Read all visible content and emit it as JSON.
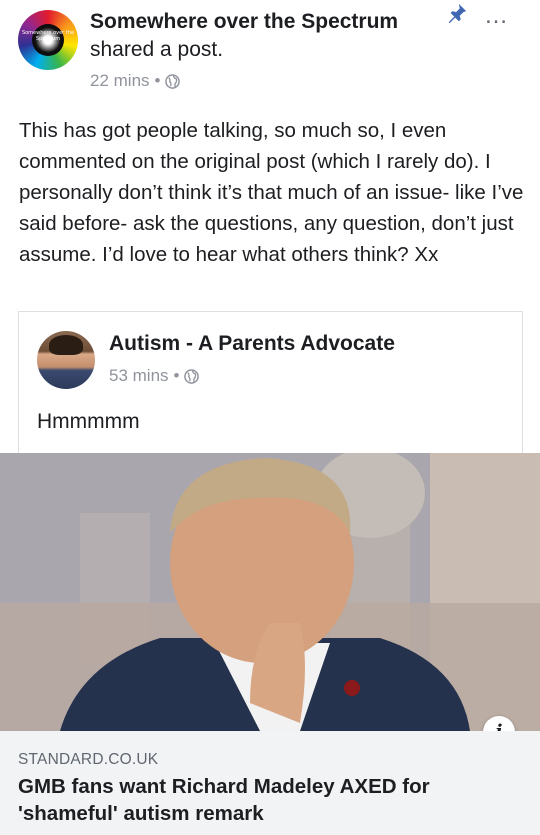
{
  "post": {
    "page_name": "Somewhere over the Spectrum",
    "action": "shared a post.",
    "time": "22 mins",
    "separator": "•",
    "avatar_text": "Somewhere over the Spectrum",
    "body": "This has got people talking, so much so, I even commented on the original post (which I rarely do). I personally don’t think it’s that much of an issue- like I’ve said before- ask the questions, any question, don’t just assume. I’d love to hear what others think? Xx",
    "more_label": "…",
    "icons": {
      "pin": "pin-icon",
      "more": "more-icon",
      "privacy": "globe-icon"
    }
  },
  "shared": {
    "page_name": "Autism - A Parents Advocate",
    "time": "53 mins",
    "separator": "•",
    "text": "Hmmmmm"
  },
  "link": {
    "domain": "STANDARD.CO.UK",
    "title": "GMB fans want Richard Madeley AXED for 'shameful' autism remark",
    "info_label": "i"
  },
  "colors": {
    "accent": "#4267b2",
    "meta": "#90949c",
    "link_bg": "#f2f3f5",
    "text": "#1c1e21"
  }
}
